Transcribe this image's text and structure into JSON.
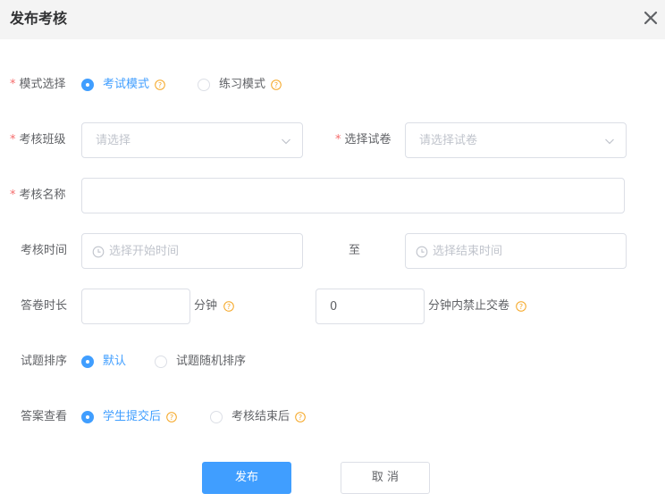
{
  "dialog": {
    "title": "发布考核",
    "close_icon": "close-icon"
  },
  "mode": {
    "label": "模式选择",
    "options": [
      {
        "label": "考试模式",
        "checked": true
      },
      {
        "label": "练习模式",
        "checked": false
      }
    ]
  },
  "class_select": {
    "label": "考核班级",
    "placeholder": "请选择"
  },
  "paper_select": {
    "label": "选择试卷",
    "placeholder": "请选择试卷"
  },
  "exam_name": {
    "label": "考核名称",
    "value": ""
  },
  "exam_time": {
    "label": "考核时间",
    "start_placeholder": "选择开始时间",
    "separator": "至",
    "end_placeholder": "选择结束时间"
  },
  "duration": {
    "label": "答卷时长",
    "value": "",
    "unit": "分钟",
    "no_submit_value": "0",
    "no_submit_label": "分钟内禁止交卷"
  },
  "order": {
    "label": "试题排序",
    "options": [
      {
        "label": "默认",
        "checked": true
      },
      {
        "label": "试题随机排序",
        "checked": false
      }
    ]
  },
  "answer_view": {
    "label": "答案查看",
    "options": [
      {
        "label": "学生提交后",
        "checked": true
      },
      {
        "label": "考核结束后",
        "checked": false
      }
    ]
  },
  "buttons": {
    "publish": "发布",
    "cancel": "取 消"
  },
  "colors": {
    "primary": "#409eff",
    "required": "#f56c6c",
    "help": "#f5a623"
  }
}
